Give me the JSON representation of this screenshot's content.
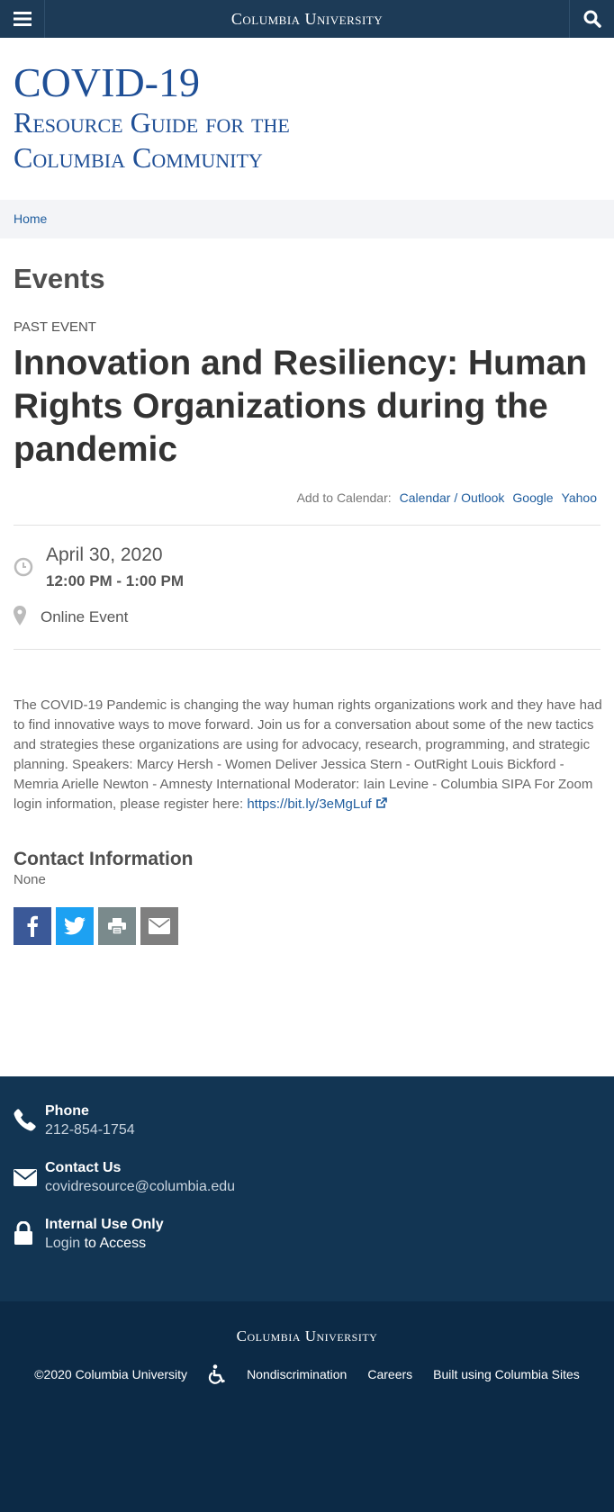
{
  "header": {
    "brand": "Columbia University"
  },
  "site": {
    "title_line1": "COVID-19",
    "title_line2": "Resource Guide for the",
    "title_line3": "Columbia Community"
  },
  "breadcrumb": {
    "home": "Home"
  },
  "page": {
    "section_title": "Events",
    "past_label": "PAST EVENT",
    "event_title": "Innovation and Resiliency: Human Rights Organizations during the pandemic"
  },
  "calendar": {
    "label": "Add to Calendar:",
    "outlook": "Calendar / Outlook",
    "google": "Google",
    "yahoo": "Yahoo"
  },
  "event": {
    "date": "April 30, 2020",
    "time": "12:00 PM - 1:00 PM",
    "location": "Online Event"
  },
  "description": {
    "text": "The COVID-19 Pandemic is changing the way human rights organizations work and they have had to find innovative ways to move forward. Join us for a conversation about some of the new tactics and strategies these organizations are using for advocacy, research, programming, and strategic planning. Speakers: Marcy Hersh - Women Deliver Jessica Stern - OutRight Louis Bickford - Memria Arielle Newton - Amnesty International Moderator: Iain Levine - Columbia SIPA For Zoom login information, please register here:",
    "link": "https://bit.ly/3eMgLuf"
  },
  "contact": {
    "heading": "Contact Information",
    "value": "None"
  },
  "colors": {
    "facebook": "#3b5998",
    "twitter": "#1da1f2",
    "print": "#7a8a8c",
    "email": "#7f7f7f",
    "navy": "#1d3b57",
    "footer": "#123553",
    "footer_bottom": "#0c2a46"
  },
  "footer": {
    "phone_label": "Phone",
    "phone_value": "212-854-1754",
    "contact_label": "Contact Us",
    "contact_value": "covidresource@columbia.edu",
    "internal_label": "Internal Use Only",
    "login_link": "Login",
    "login_suffix": " to Access",
    "brand": "Columbia University",
    "copyright": "©2020 Columbia University",
    "nondiscrimination": "Nondiscrimination",
    "careers": "Careers",
    "built": "Built using Columbia Sites"
  }
}
